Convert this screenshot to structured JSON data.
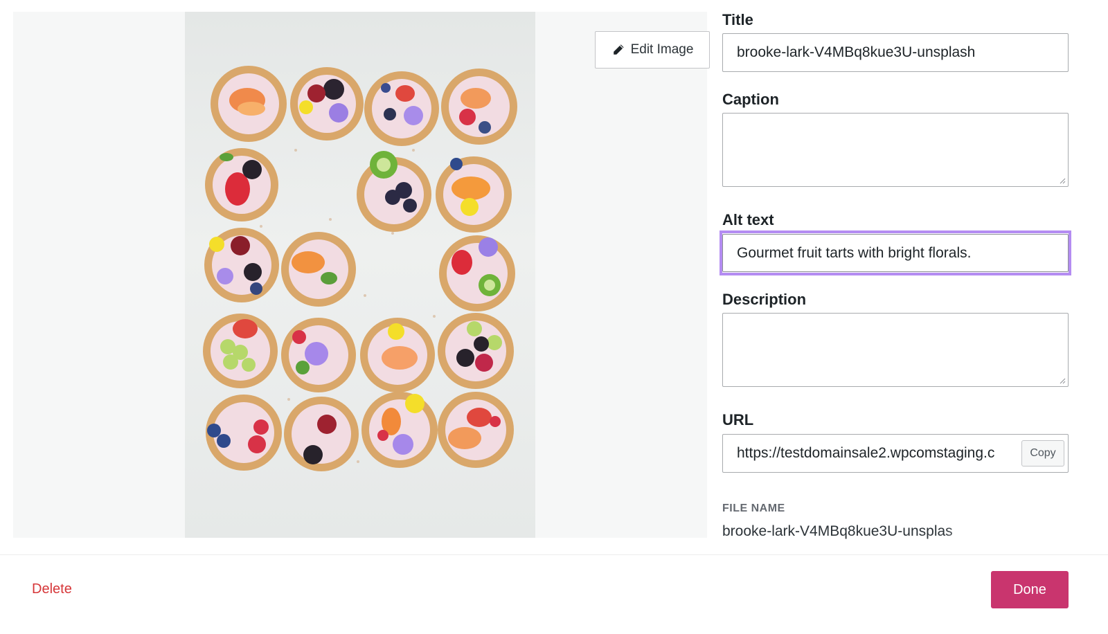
{
  "preview": {
    "edit_image_label": "Edit Image"
  },
  "fields": {
    "title_label": "Title",
    "title_value": "brooke-lark-V4MBq8kue3U-unsplash",
    "caption_label": "Caption",
    "caption_value": "",
    "alt_label": "Alt text",
    "alt_value": "Gourmet fruit tarts with bright florals.",
    "description_label": "Description",
    "description_value": "",
    "url_label": "URL",
    "url_value": "https://testdomainsale2.wpcomstaging.c",
    "copy_label": "Copy",
    "file_name_label": "FILE NAME",
    "file_name_value": "brooke-lark-V4MBq8kue3U-unsplas"
  },
  "footer": {
    "delete_label": "Delete",
    "done_label": "Done"
  },
  "colors": {
    "accent_done": "#c9356e",
    "delete_red": "#d63638",
    "highlight": "#b48cf2"
  }
}
